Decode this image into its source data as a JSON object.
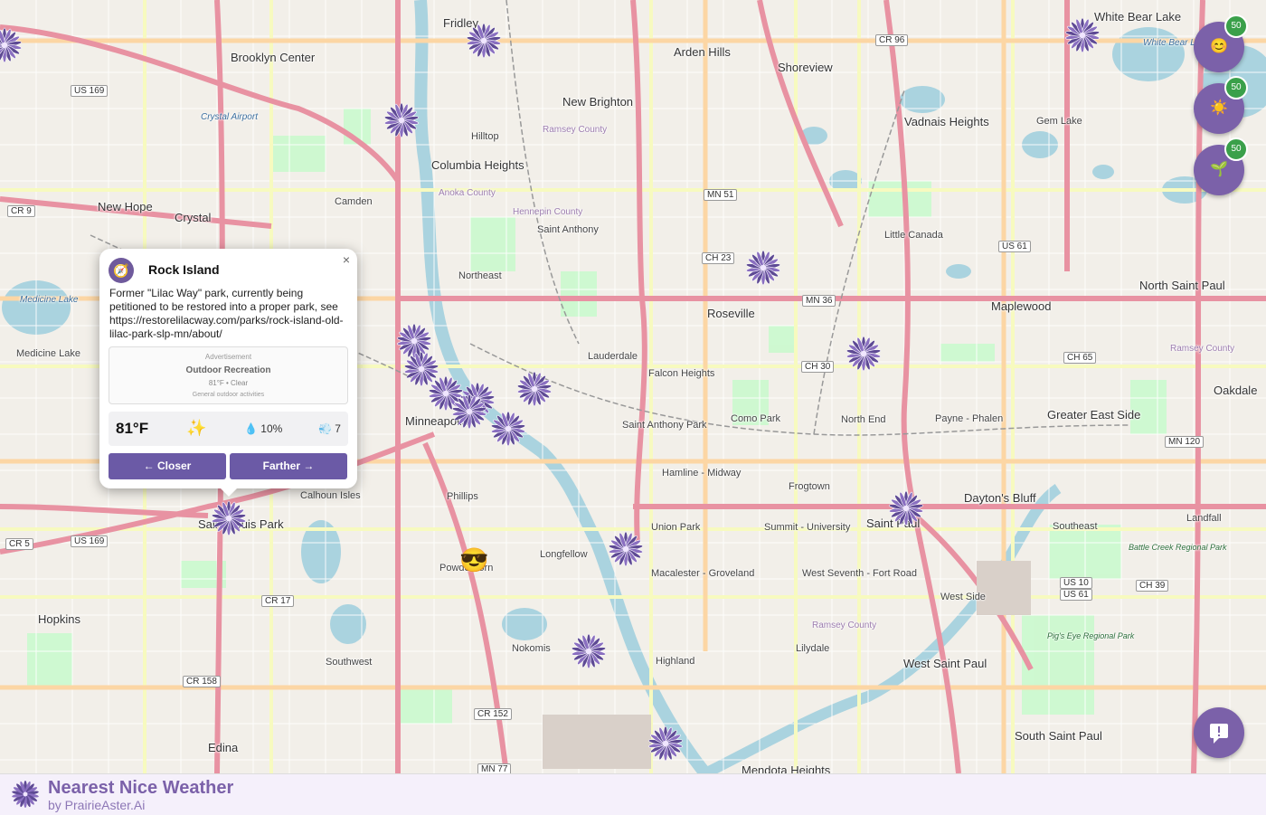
{
  "map": {
    "cities": [
      {
        "name": "Fridley"
      },
      {
        "name": "Brooklyn Center"
      },
      {
        "name": "Arden Hills"
      },
      {
        "name": "Shoreview"
      },
      {
        "name": "White Bear Lake"
      },
      {
        "name": "New Brighton"
      },
      {
        "name": "Vadnais Heights"
      },
      {
        "name": "Columbia Heights"
      },
      {
        "name": "New Hope"
      },
      {
        "name": "Crystal"
      },
      {
        "name": "Camden"
      },
      {
        "name": "Saint Anthony"
      },
      {
        "name": "Little Canada"
      },
      {
        "name": "Northeast"
      },
      {
        "name": "Roseville"
      },
      {
        "name": "Maplewood"
      },
      {
        "name": "North Saint Paul"
      },
      {
        "name": "Lauderdale"
      },
      {
        "name": "Falcon Heights"
      },
      {
        "name": "Saint Anthony Park"
      },
      {
        "name": "Como Park"
      },
      {
        "name": "North End"
      },
      {
        "name": "Payne - Phalen"
      },
      {
        "name": "Greater East Side"
      },
      {
        "name": "Oakdale"
      },
      {
        "name": "Minneapolis"
      },
      {
        "name": "Hamline - Midway"
      },
      {
        "name": "Frogtown"
      },
      {
        "name": "Dayton's Bluff"
      },
      {
        "name": "Calhoun Isles"
      },
      {
        "name": "Phillips"
      },
      {
        "name": "Union Park"
      },
      {
        "name": "Summit - University"
      },
      {
        "name": "Saint Paul"
      },
      {
        "name": "Landfall"
      },
      {
        "name": "Southeast"
      },
      {
        "name": "Saint Louis Park"
      },
      {
        "name": "Longfellow"
      },
      {
        "name": "Powderhorn"
      },
      {
        "name": "Macalester - Groveland"
      },
      {
        "name": "West Seventh - Fort Road"
      },
      {
        "name": "West Side"
      },
      {
        "name": "Hopkins"
      },
      {
        "name": "Nokomis"
      },
      {
        "name": "Highland"
      },
      {
        "name": "Lilydale"
      },
      {
        "name": "West Saint Paul"
      },
      {
        "name": "Southwest"
      },
      {
        "name": "South Saint Paul"
      },
      {
        "name": "Edina"
      },
      {
        "name": "Mendota Heights"
      },
      {
        "name": "Medicine Lake"
      },
      {
        "name": "Gem Lake"
      },
      {
        "name": "Hilltop"
      }
    ],
    "water_labels": [
      "Crystal Airport",
      "Medicine Lake",
      "White Bear Lake"
    ],
    "park_labels": [
      "Battle Creek Regional Park",
      "Pig's Eye Regional Park"
    ],
    "county_labels": [
      "Anoka County",
      "Hennepin County",
      "Ramsey County",
      "Ramsey County",
      "Ramsey County"
    ],
    "shields": [
      "CR 96",
      "MN 51",
      "CH 23",
      "MN 36",
      "CH 30",
      "US 61",
      "CH 65",
      "MN 120",
      "US 169",
      "US 169",
      "CR 9",
      "CR 5",
      "CR 17",
      "CR 158",
      "CR 152",
      "MN 77",
      "US 10",
      "US 61",
      "CH 39"
    ]
  },
  "popup": {
    "icon": "compass-icon",
    "icon_glyph": "🧭",
    "close": "×",
    "title": "Rock Island",
    "description": "Former \"Lilac Way\" park, currently being petitioned to be restored into a proper park, see https://restorelilacway.com/parks/rock-island-old-lilac-park-slp-mn/about/",
    "ad": {
      "label": "Advertisement",
      "title": "Outdoor Recreation",
      "line": "81°F • Clear",
      "sub": "General outdoor activities"
    },
    "weather": {
      "temp": "81°F",
      "condition_icon": "sparkles-icon",
      "condition_glyph": "✨",
      "precip_glyph": "💧",
      "precip": "10%",
      "wind_glyph": "💨",
      "wind": "7"
    },
    "closer_label": "← Closer",
    "farther_label": "Farther →"
  },
  "filters": [
    {
      "name": "mood-filter",
      "glyph": "😊",
      "badge": "50"
    },
    {
      "name": "sun-filter",
      "glyph": "☀️",
      "badge": "50"
    },
    {
      "name": "seedling-filter",
      "glyph": "🌱",
      "badge": "50"
    }
  ],
  "feedback_glyph": "!",
  "user_marker": "😎",
  "footer": {
    "title": "Nearest Nice Weather",
    "subtitle": "by PrairieAster.Ai"
  },
  "colors": {
    "brand": "#7b61a9",
    "badge": "#3aa04a",
    "button": "#6b5aa6",
    "water": "#aad3df",
    "park": "#c8facc"
  }
}
